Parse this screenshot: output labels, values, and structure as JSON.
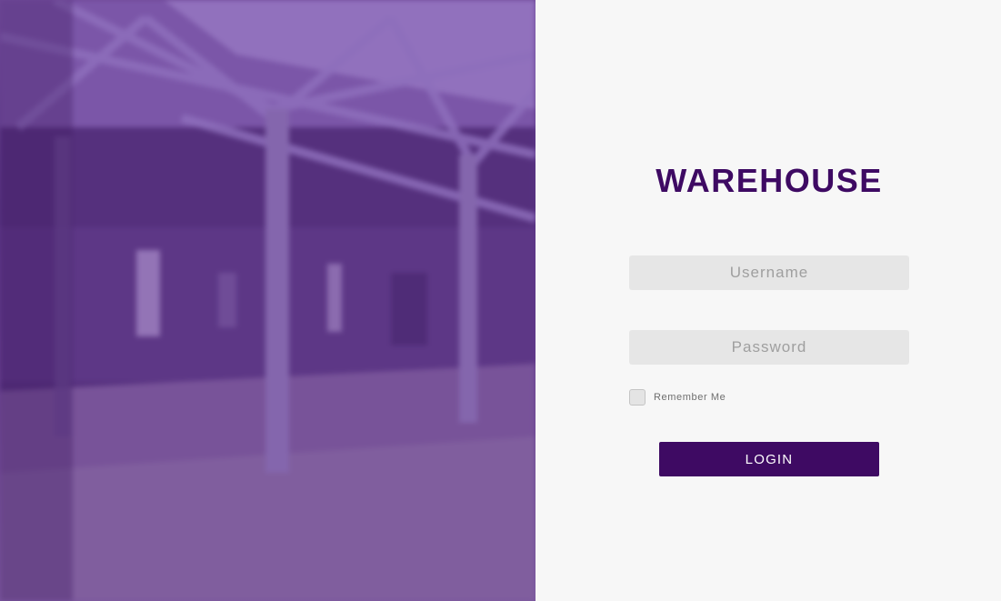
{
  "brand": {
    "title": "WAREHOUSE",
    "color": "#3e0a63"
  },
  "login_form": {
    "username_placeholder": "Username",
    "password_placeholder": "Password",
    "remember_label": "Remember Me",
    "remember_checked": false,
    "login_label": "LOGIN",
    "accent_color": "#3e0a63"
  },
  "hero": {
    "image_subject": "warehouse-interior-photo",
    "overlay_color": "#5a3585"
  }
}
